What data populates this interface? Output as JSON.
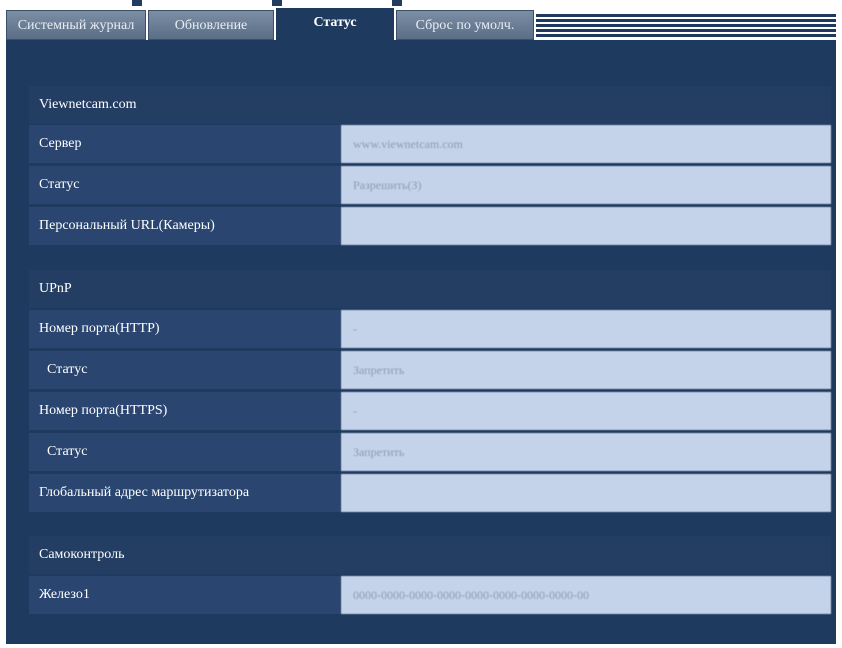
{
  "tabs": [
    {
      "label": "Системный журнал",
      "active": false
    },
    {
      "label": "Обновление",
      "active": false
    },
    {
      "label": "Статус",
      "active": true
    },
    {
      "label": "Сброс по умолч.",
      "active": false
    }
  ],
  "sections": {
    "viewnetcam": {
      "title": "Viewnetcam.com",
      "rows": {
        "server": {
          "label": "Сервер",
          "value": "www.viewnetcam.com"
        },
        "status": {
          "label": "Статус",
          "value": "Разрешить(З)"
        },
        "personal_url": {
          "label": "Персональный URL(Камеры)",
          "value": ""
        }
      }
    },
    "upnp": {
      "title": "UPnP",
      "rows": {
        "http_port": {
          "label": "Номер порта(HTTP)",
          "value": "-"
        },
        "http_status": {
          "label": "Статус",
          "value": "Запретить"
        },
        "https_port": {
          "label": "Номер порта(HTTPS)",
          "value": "-"
        },
        "https_status": {
          "label": "Статус",
          "value": "Запретить"
        },
        "router_address": {
          "label": "Глобальный адрес маршрутизатора",
          "value": ""
        }
      }
    },
    "selfcheck": {
      "title": "Самоконтроль",
      "rows": {
        "hardware1": {
          "label": "Железо1",
          "value": "0000-0000-0000-0000-0000-0000-0000-0000-00"
        }
      }
    }
  },
  "colors": {
    "background": "#1f3a5f",
    "section_header": "#243e63",
    "label_cell": "#2a4670",
    "value_cell": "#c4d3ea"
  }
}
